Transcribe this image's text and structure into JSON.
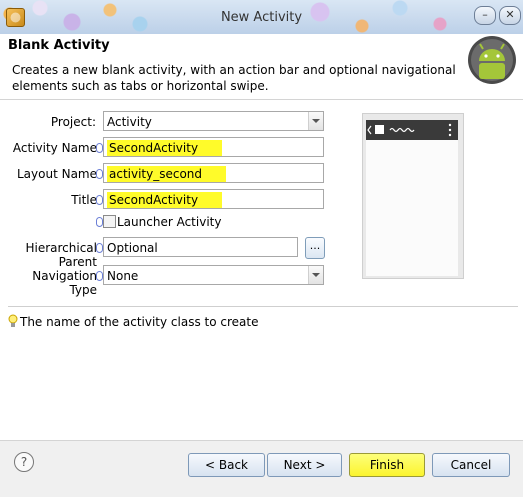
{
  "window": {
    "title": "New Activity",
    "minimize_label": "–",
    "close_label": "✕"
  },
  "header": {
    "title": "Blank Activity",
    "description": "Creates a new blank activity, with an action bar and optional navigational elements such as tabs or horizontal swipe."
  },
  "form": {
    "project": {
      "label": "Project:",
      "value": "Activity"
    },
    "activity_name": {
      "label": "Activity Name",
      "value": "SecondActivity"
    },
    "layout_name": {
      "label": "Layout Name",
      "value": "activity_second"
    },
    "title": {
      "label": "Title",
      "value": "SecondActivity"
    },
    "launcher": {
      "label": "Launcher Activity",
      "checked": false
    },
    "hierarchical_parent": {
      "label": "Hierarchical Parent",
      "value": "Optional",
      "browse_label": "..."
    },
    "navigation_type": {
      "label": "Navigation Type",
      "value": "None"
    }
  },
  "hint": "The name of the activity class to create",
  "buttons": {
    "help": "?",
    "back": "< Back",
    "next": "Next >",
    "finish": "Finish",
    "cancel": "Cancel"
  },
  "colors": {
    "highlight": "#fffb2a",
    "android_green": "#a4c639"
  }
}
